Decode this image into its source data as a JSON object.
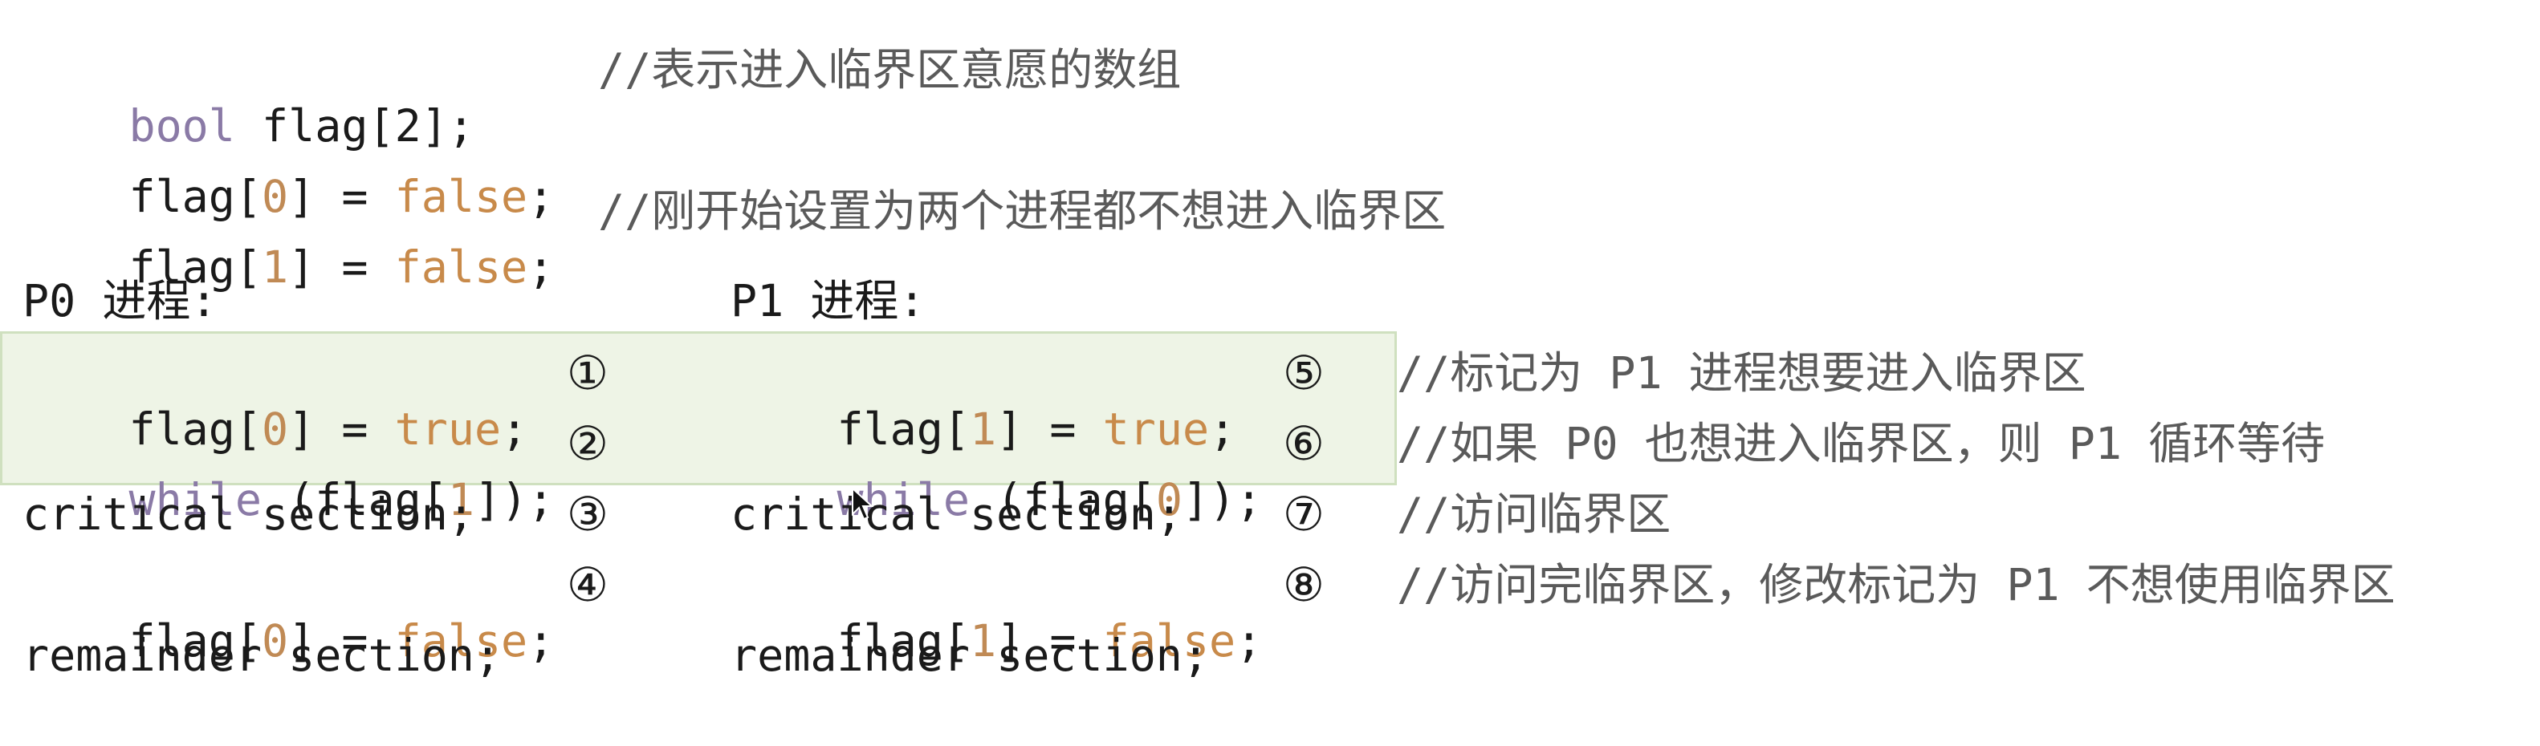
{
  "decl": {
    "kw": "bool",
    "rest": " flag[2];",
    "comment": "//表示进入临界区意愿的数组"
  },
  "init0": {
    "pre": "flag[",
    "idx": "0",
    "mid": "] = ",
    "val": "false",
    "end": ";"
  },
  "init1": {
    "pre": "flag[",
    "idx": "1",
    "mid": "] = ",
    "val": "false",
    "end": ";",
    "comment": "//刚开始设置为两个进程都不想进入临界区"
  },
  "p0": {
    "title": "P0 进程:",
    "lines": [
      {
        "pre": "flag[",
        "idx": "0",
        "mid": "] = ",
        "val": "true",
        "end": ";",
        "mark": "①"
      },
      {
        "kw": "while",
        "pre": " (flag[",
        "idx": "1",
        "end": "]);",
        "mark": "②"
      },
      {
        "text": "critical section;",
        "mark": "③"
      },
      {
        "pre": "flag[",
        "idx": "0",
        "mid": "] = ",
        "val": "false",
        "end": ";",
        "mark": "④"
      },
      {
        "text": "remainder section;"
      }
    ]
  },
  "p1": {
    "title": "P1 进程:",
    "lines": [
      {
        "pre": "flag[",
        "idx": "1",
        "mid": "] = ",
        "val": "true",
        "end": ";",
        "mark": "⑤",
        "comment": "//标记为 P1 进程想要进入临界区"
      },
      {
        "kw": "while",
        "pre": " (flag[",
        "idx": "0",
        "end": "]);",
        "mark": "⑥",
        "comment": "//如果 P0 也想进入临界区，则 P1 循环等待"
      },
      {
        "text": "critical section;",
        "mark": "⑦",
        "comment": "//访问临界区"
      },
      {
        "pre": "flag[",
        "idx": "1",
        "mid": "] = ",
        "val": "false",
        "end": ";",
        "mark": "⑧",
        "comment": "//访问完临界区，修改标记为 P1 不想使用临界区"
      },
      {
        "text": "remainder section;"
      }
    ]
  },
  "colors": {
    "keyword": "#8a7aa6",
    "number": "#c08a55",
    "boolean": "#c88a4a",
    "highlight_bg": "#eef4e6",
    "highlight_border": "#cfe0bf"
  }
}
